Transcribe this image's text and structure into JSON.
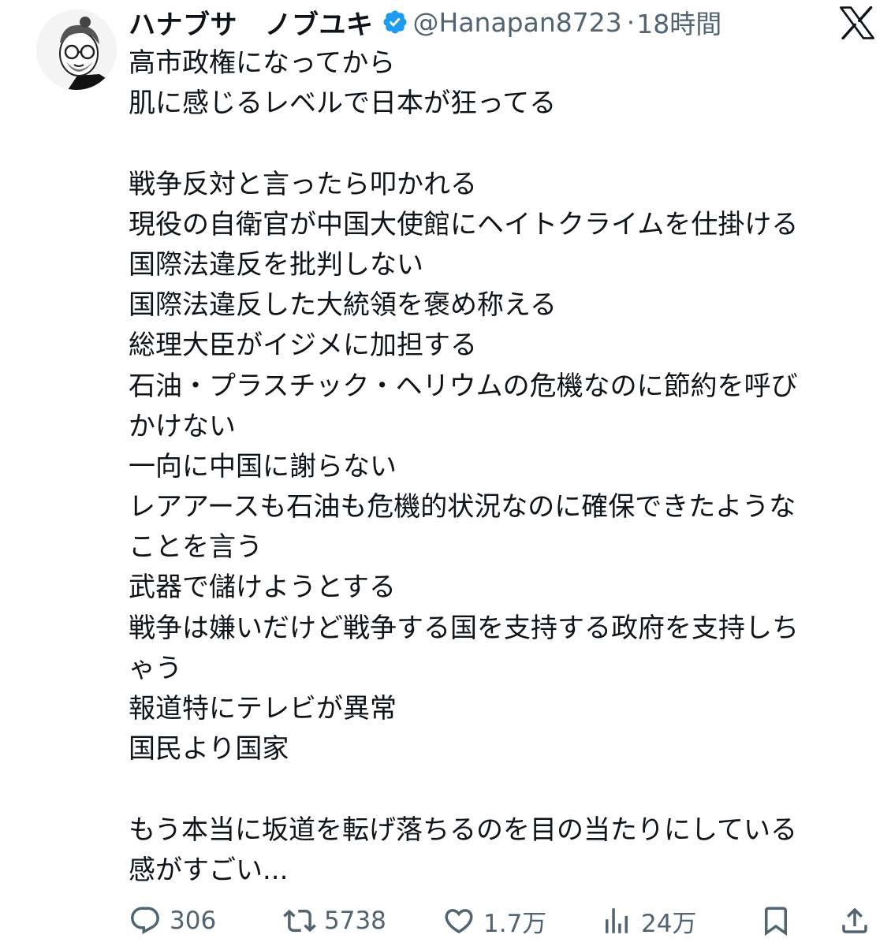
{
  "author": {
    "display_name": "ハナブサ　ノブユキ",
    "handle": "@Hanapan8723",
    "separator": "·",
    "time": "18時間",
    "verified": true
  },
  "tweet": {
    "lines": [
      "高市政権になってから",
      "肌に感じるレベルで日本が狂ってる",
      "",
      "戦争反対と言ったら叩かれる",
      "現役の自衛官が中国大使館にヘイトクライムを仕掛ける",
      "国際法違反を批判しない",
      "国際法違反した大統領を褒め称える",
      "総理大臣がイジメに加担する",
      "石油・プラスチック・ヘリウムの危機なのに節約を呼び",
      "かけない",
      "一向に中国に謝らない",
      "レアアースも石油も危機的状況なのに確保できたような",
      "ことを言う",
      "武器で儲けようとする",
      "戦争は嫌いだけど戦争する国を支持する政府を支持しち",
      "ゃう",
      "報道特にテレビが異常",
      "国民より国家",
      "",
      "もう本当に坂道を転げ落ちるのを目の当たりにしている",
      "感がすごい..."
    ]
  },
  "actions": {
    "replies": "306",
    "retweets": "5738",
    "likes": "1.7万",
    "views": "24万"
  },
  "icons": {
    "verified": "verified-badge-icon",
    "logo": "x-logo-icon",
    "reply": "reply-icon",
    "retweet": "retweet-icon",
    "like": "heart-icon",
    "views": "views-icon",
    "bookmark": "bookmark-icon",
    "share": "share-icon"
  },
  "colors": {
    "text": "#0f1419",
    "secondary": "#536471",
    "verified": "#1d9bf0",
    "background": "#ffffff"
  }
}
